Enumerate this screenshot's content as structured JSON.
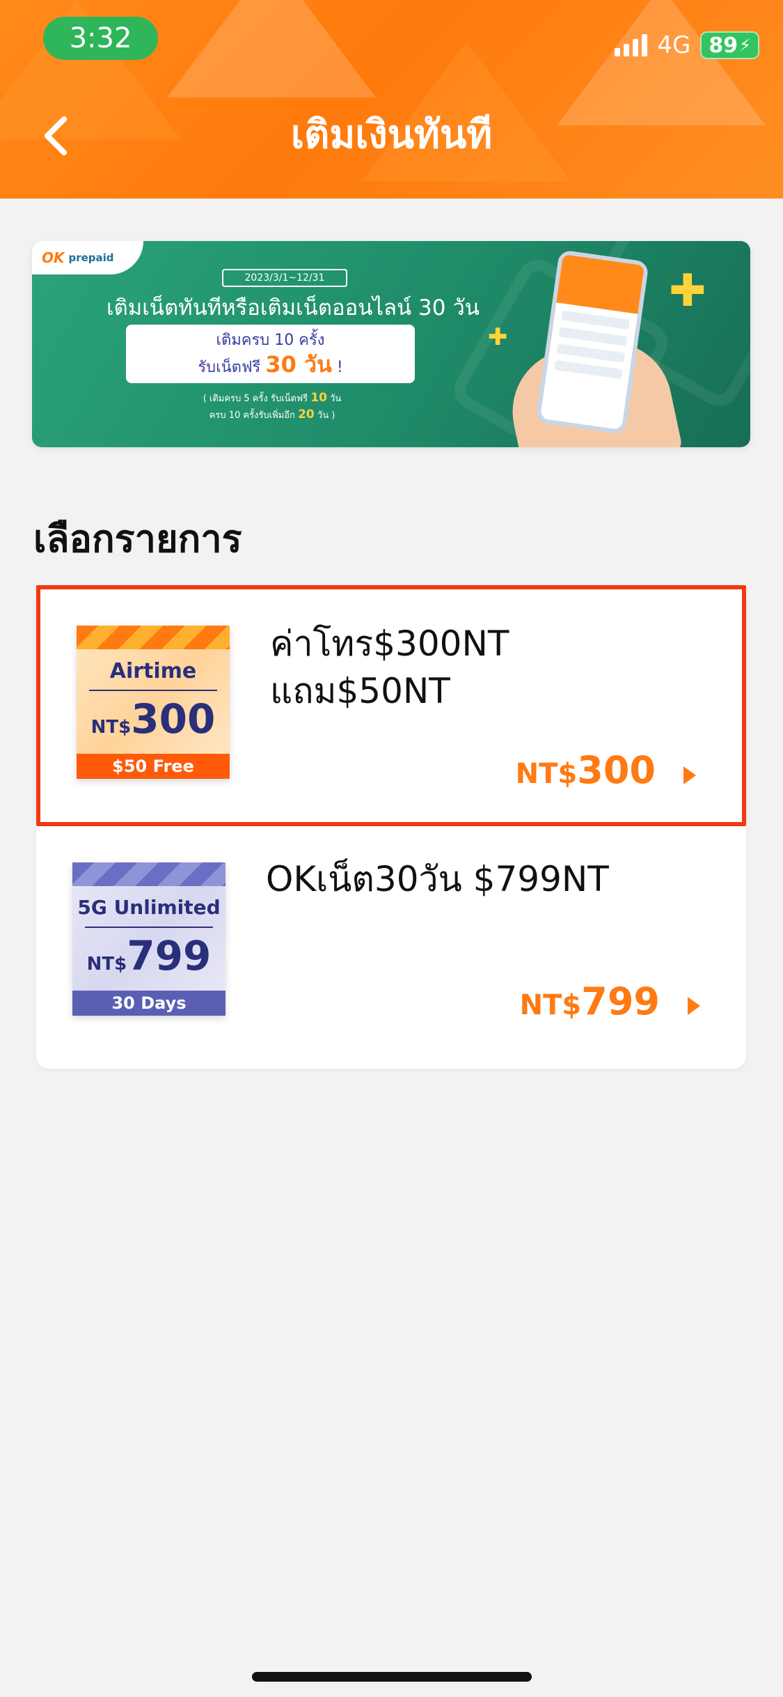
{
  "status_bar": {
    "time": "3:32",
    "network": "4G",
    "battery": "89"
  },
  "header": {
    "title": "เติมเงินทันที"
  },
  "banner": {
    "logo_ok": "OK",
    "logo_prepaid": "prepaid",
    "date_range": "2023/3/1~12/31",
    "headline": "เติมเน็ตทันทีหรือเติมเน็ตออนไลน์ 30 วัน",
    "box_line1": "เติมครบ 10 ครั้ง",
    "box_line2_prefix": "รับเน็ตฟรี",
    "box_line2_highlight": "30 วัน",
    "box_line2_suffix": "!",
    "note_line1_prefix": "( เติมครบ 5 ครั้ง รับเน็ตฟรี",
    "note_line1_highlight": "10",
    "note_line1_suffix": "วัน",
    "note_line2_prefix": "ครบ 10 ครั้งรับเพิ่มอีก",
    "note_line2_highlight": "20",
    "note_line2_suffix": "วัน )"
  },
  "section": {
    "title": "เลือกรายการ"
  },
  "products": [
    {
      "thumb_title": "Airtime",
      "thumb_currency": "NT$",
      "thumb_amount": "300",
      "thumb_footer": "$50 Free",
      "name_line1": "ค่าโทร$300NT",
      "name_line2": "แถม$50NT",
      "price_currency": "NT$",
      "price_amount": "300",
      "selected": true
    },
    {
      "thumb_title": "5G Unlimited",
      "thumb_currency": "NT$",
      "thumb_amount": "799",
      "thumb_footer": "30 Days",
      "name_line1": "OKเน็ต30วัน $799NT",
      "name_line2": "",
      "price_currency": "NT$",
      "price_amount": "799",
      "selected": false
    }
  ],
  "colors": {
    "brand_orange": "#ff7a12",
    "selection_red": "#ef3a14",
    "banner_green": "#1f8b69",
    "airtime_navy": "#2a2f7a",
    "unlimited_purple": "#5b5fb4"
  }
}
